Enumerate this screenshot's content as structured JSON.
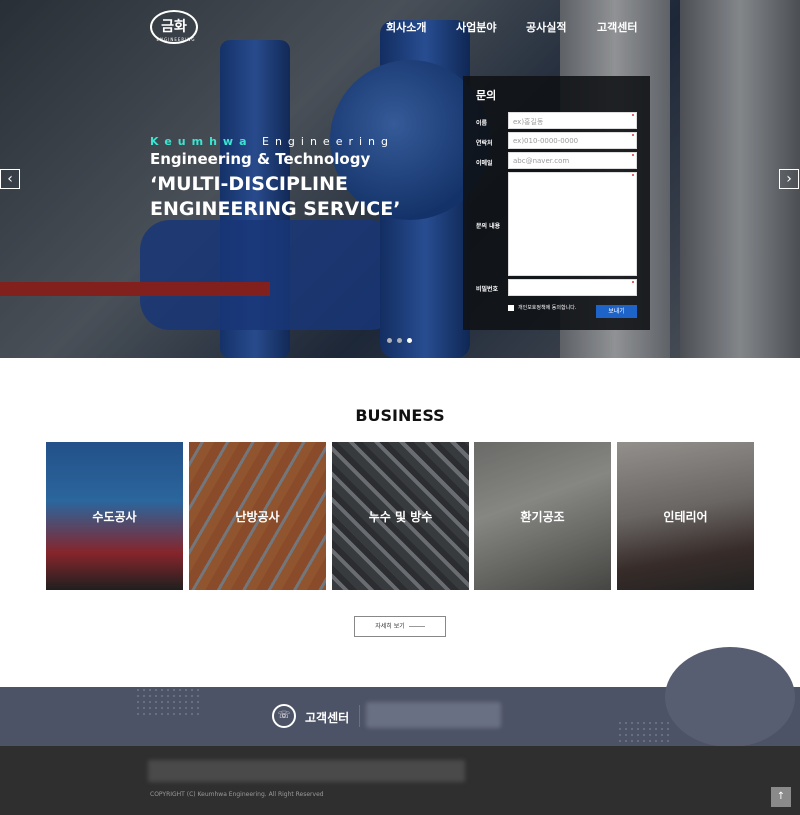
{
  "header": {
    "logo_text": "금화",
    "logo_sub": "ENGINEERING",
    "nav": [
      "회사소개",
      "사업분야",
      "공사실적",
      "고객센터"
    ]
  },
  "hero": {
    "tagline_accent": "Keumhwa",
    "tagline_rest": " Engineering",
    "subtitle": "Engineering & Technology",
    "title": "‘MULTI-DISCIPLINE ENGINEERING SERVICE’",
    "prev_icon": "chevron-left-icon",
    "next_icon": "chevron-right-icon",
    "prev_glyph": "‹",
    "next_glyph": "›",
    "slide_count": 3,
    "active_slide": 3
  },
  "form": {
    "title": "문의",
    "labels": {
      "name": "이름",
      "phone": "연락처",
      "email": "이메일",
      "message": "문의 내용",
      "password": "비밀번호"
    },
    "placeholders": {
      "name": "ex)홍길동",
      "phone": "ex)010-0000-0000",
      "email": "abc@naver.com"
    },
    "agree": "개인보호정책에 동의합니다.",
    "submit": "보내기"
  },
  "business": {
    "title": "BUSINESS",
    "items": [
      "수도공사",
      "난방공사",
      "누수 및 방수",
      "환기공조",
      "인테리어"
    ],
    "more": "자세히 보기"
  },
  "contact_band": {
    "label": "고객센터",
    "icon": "phone-icon",
    "phone_glyph": "☏"
  },
  "footer": {
    "copyright": "COPYRIGHT (C) Keumhwa Engineering. All Right Reserved",
    "top_icon": "arrow-up-icon",
    "top_glyph": "↑"
  }
}
